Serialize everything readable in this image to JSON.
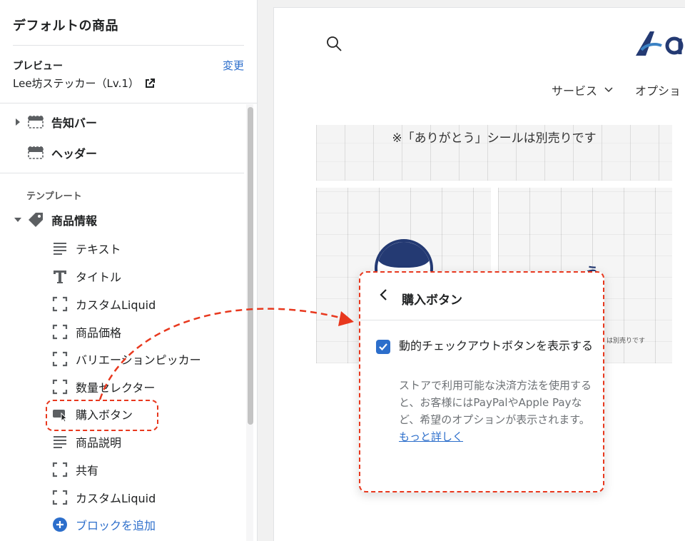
{
  "sidebar": {
    "title": "デフォルトの商品",
    "preview": {
      "label": "プレビュー",
      "change_label": "変更",
      "value": "Lee坊ステッカー（Lv.1）"
    },
    "top_items": [
      {
        "label": "告知バー",
        "icon": "announcement-bar-icon"
      },
      {
        "label": "ヘッダー",
        "icon": "header-icon"
      }
    ],
    "section_label": "テンプレート",
    "product_section": {
      "label": "商品情報",
      "icon": "tag-icon"
    },
    "blocks": [
      {
        "label": "テキスト",
        "icon": "text-lines-icon"
      },
      {
        "label": "タイトル",
        "icon": "title-t-icon"
      },
      {
        "label": "カスタムLiquid",
        "icon": "bracket-frame-icon"
      },
      {
        "label": "商品価格",
        "icon": "bracket-frame-icon"
      },
      {
        "label": "バリエーションピッカー",
        "icon": "bracket-frame-icon"
      },
      {
        "label": "数量セレクター",
        "icon": "bracket-frame-icon"
      },
      {
        "label": "購入ボタン",
        "icon": "buy-button-icon"
      },
      {
        "label": "商品説明",
        "icon": "text-lines-icon"
      },
      {
        "label": "共有",
        "icon": "bracket-frame-icon"
      },
      {
        "label": "カスタムLiquid",
        "icon": "bracket-frame-icon"
      }
    ],
    "add_block_label": "ブロックを追加"
  },
  "storefront": {
    "nav": {
      "services": "サービス",
      "options": "オプショ"
    },
    "banner_text": "※「ありがとう」シールは別売りです",
    "tile_word": "う",
    "tile_small_text": "は別売りです"
  },
  "popup": {
    "title": "購入ボタン",
    "checkbox_checked": true,
    "checkbox_label": "動的チェックアウトボタンを表示する",
    "help_text": "ストアで利用可能な決済方法を使用すると、お客様にはPayPalやApple Payなど、希望のオプションが表示されます。",
    "help_link": "もっと詳しく"
  },
  "colors": {
    "accent": "#2c6ecb",
    "highlight": "#e8381e",
    "brand_navy": "#243a73"
  }
}
